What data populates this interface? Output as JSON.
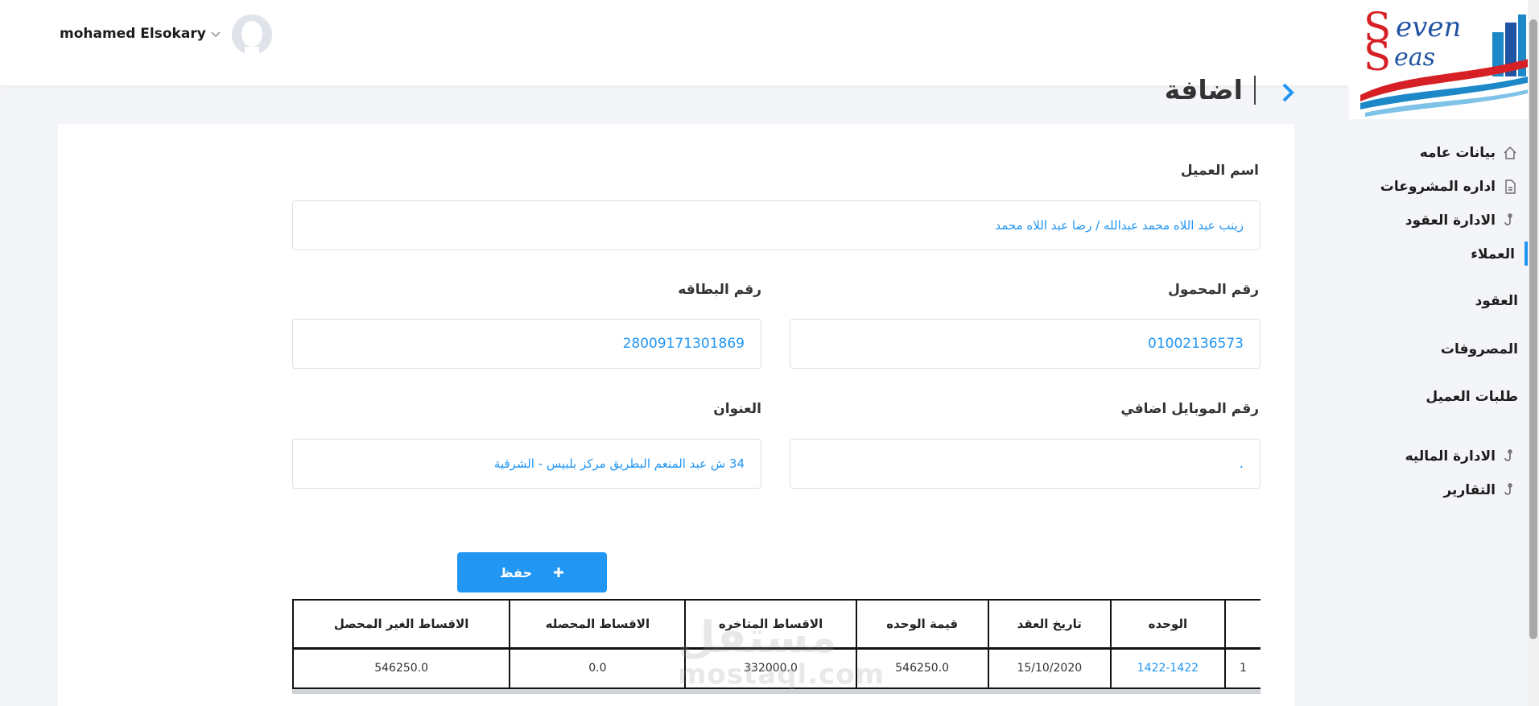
{
  "header": {
    "user_name": "mohamed Elsokary"
  },
  "logo": {
    "text_s": "S",
    "text_even": "even",
    "text_s2": "S",
    "text_eas": "eas"
  },
  "sidebar": {
    "items": [
      {
        "label": "بيانات عامه",
        "icon": "home-icon"
      },
      {
        "label": "اداره المشروعات",
        "icon": "document-icon"
      },
      {
        "label": "الادارة العقود",
        "icon": "hook-icon"
      },
      {
        "label": "العملاء"
      },
      {
        "label": "العقود"
      },
      {
        "label": "المصروفات"
      },
      {
        "label": "طلبات العميل"
      },
      {
        "label": "الادارة الماليه",
        "icon": "hook-icon"
      },
      {
        "label": "التقارير",
        "icon": "hook-icon"
      }
    ]
  },
  "page": {
    "title": "اضافة"
  },
  "form": {
    "client_name_label": "اسم العميل",
    "client_name_value": "زينب عبد اللاه محمد  عبدالله / رضا عبد اللاه محمد",
    "mobile_label": "رقم المحمول",
    "mobile_value": "01002136573",
    "id_card_label": "رقم البطاقه",
    "id_card_value": "28009171301869",
    "extra_mobile_label": "رقم الموبايل اضافي",
    "extra_mobile_value": ".",
    "address_label": "العنوان",
    "address_value": "34 ش عبد المنعم البطريق مركز بلبيس - الشرقية"
  },
  "save_button": {
    "label": "حفظ",
    "icon": "plus-icon"
  },
  "table": {
    "columns": [
      "",
      "الوحده",
      "تاريخ العقد",
      "قيمة الوحده",
      "الاقساط المتاخره",
      "الاقساط المحصله",
      "الاقساط الغير المحصل"
    ],
    "rows": [
      [
        "1",
        "1422-1422",
        "15/10/2020",
        "546250.0",
        "332000.0",
        "0.0",
        "546250.0"
      ]
    ]
  },
  "watermark": {
    "line1": "مستقل",
    "line2": "mostaql.com"
  },
  "colors": {
    "accent": "#2196f3",
    "brand_red": "#d62026",
    "brand_blue": "#2153a3"
  }
}
